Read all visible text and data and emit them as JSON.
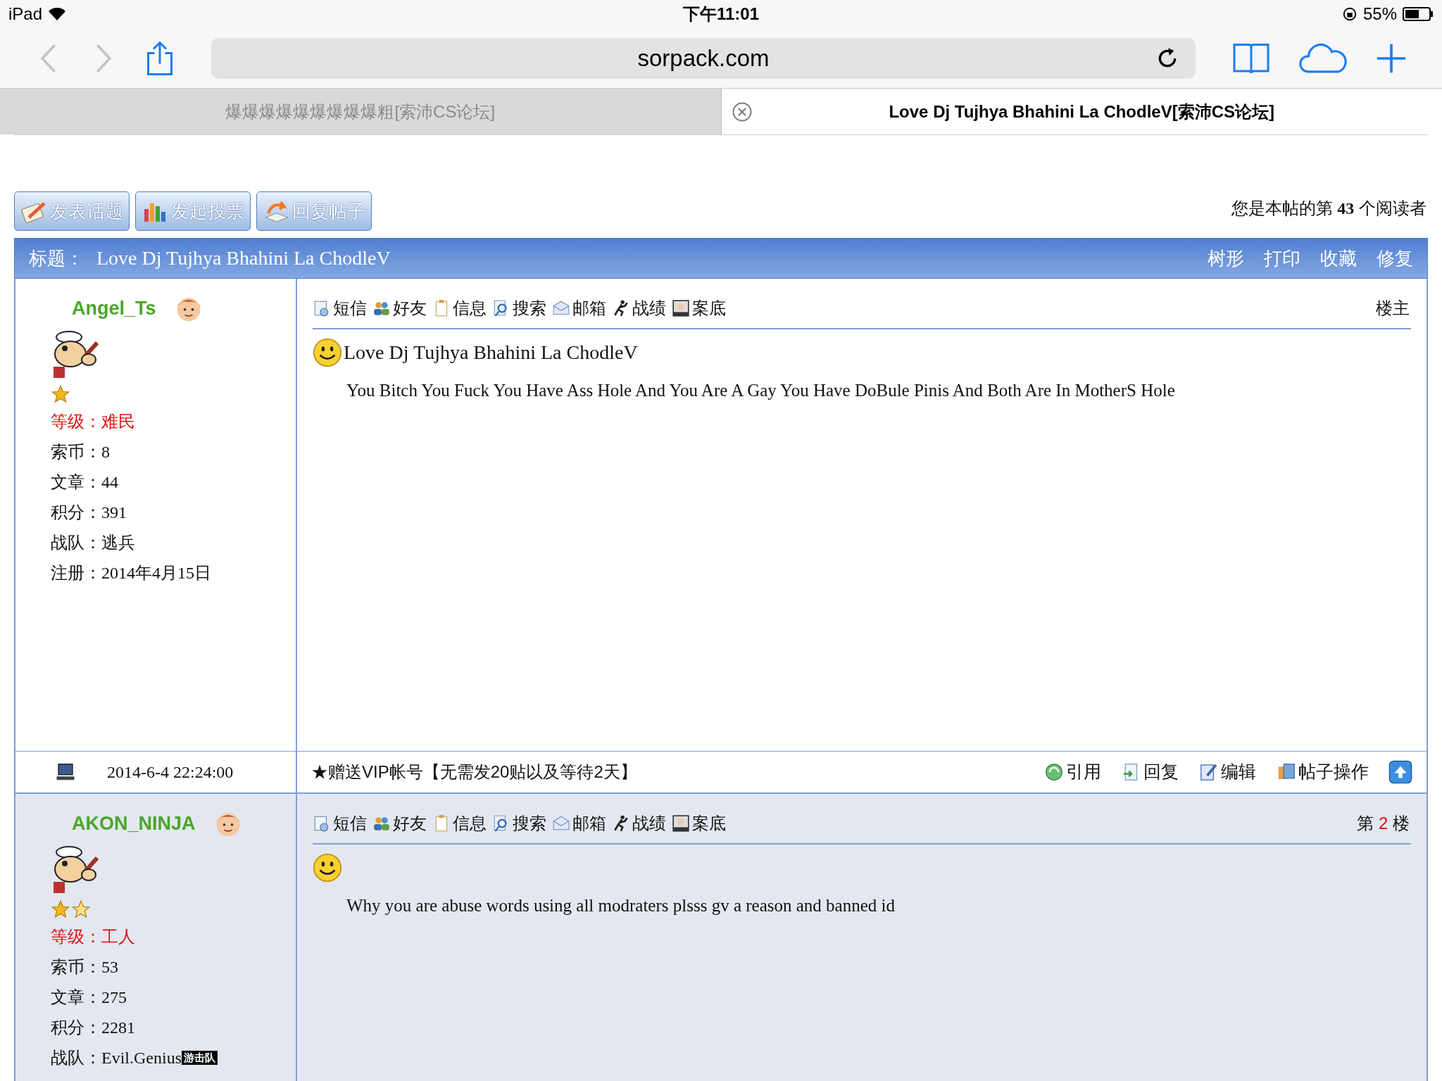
{
  "status_bar": {
    "device": "iPad",
    "time": "下午11:01",
    "battery": "55%"
  },
  "browser": {
    "back_disabled": true,
    "forward_disabled": true,
    "url": "sorpack.com"
  },
  "tabs": [
    {
      "label": "爆爆爆爆爆爆爆爆爆粗[索沛CS论坛]",
      "selected": false
    },
    {
      "label": "Love Dj Tujhya Bhahini La ChodleV[索沛CS论坛]",
      "selected": true
    }
  ],
  "actions": [
    {
      "kind": "topic",
      "label": "发表话题"
    },
    {
      "kind": "poll",
      "label": "发起投票"
    },
    {
      "kind": "reply",
      "label": "回复帖子"
    }
  ],
  "reader_count": {
    "prefix": "您是本帖的第",
    "number": "43",
    "suffix": "个阅读者"
  },
  "thread_header": {
    "label": "标题：",
    "title": "Love Dj Tujhya Bhahini La ChodleV",
    "links": [
      "树形",
      "打印",
      "收藏",
      "修复"
    ]
  },
  "posts": [
    {
      "username": "Angel_Ts",
      "rank_icons": [
        {
          "kind": "star"
        }
      ],
      "rank": {
        "label": "等级：",
        "value": "难民"
      },
      "fields": [
        {
          "label": "索币：",
          "value": "8"
        },
        {
          "label": "文章：",
          "value": "44"
        },
        {
          "label": "积分：",
          "value": "391"
        },
        {
          "label": "战队：",
          "value": "逃兵"
        },
        {
          "label": "注册：",
          "value": "2014年4月15日"
        }
      ],
      "tools": [
        {
          "kind": "message",
          "label": "短信"
        },
        {
          "kind": "friends",
          "label": "好友"
        },
        {
          "kind": "info",
          "label": "信息"
        },
        {
          "kind": "search",
          "label": "搜索"
        },
        {
          "kind": "mail",
          "label": "邮箱"
        },
        {
          "kind": "stats",
          "label": "战绩"
        },
        {
          "kind": "record",
          "label": "案底"
        }
      ],
      "floor": {
        "kind": "owner",
        "text": "楼主"
      },
      "title": "Love Dj Tujhya Bhahini La ChodleV",
      "body": "You Bitch You Fuck You Have Ass Hole And You Are A Gay You Have DoBule Pinis  And Both Are In MotherS Hole",
      "highlighted": false,
      "footer": {
        "date": "2014-6-4 22:24:00",
        "notice": "★赠送VIP帐号【无需发20贴以及等待2天】",
        "buttons": [
          {
            "kind": "quote",
            "label": "引用"
          },
          {
            "kind": "reply",
            "label": "回复"
          },
          {
            "kind": "edit",
            "label": "编辑"
          },
          {
            "kind": "manage",
            "label": "帖子操作"
          }
        ]
      }
    },
    {
      "username": "AKON_NINJA",
      "rank_icons": [
        {
          "kind": "star"
        },
        {
          "kind": "star"
        }
      ],
      "rank": {
        "label": "等级：",
        "value": "工人"
      },
      "fields": [
        {
          "label": "索币：",
          "value": "53"
        },
        {
          "label": "文章：",
          "value": "275"
        },
        {
          "label": "积分：",
          "value": "2281"
        },
        {
          "label": "战队：",
          "value": "Evil.Genius",
          "badge": "游击队"
        }
      ],
      "tools": [
        {
          "kind": "message",
          "label": "短信"
        },
        {
          "kind": "friends",
          "label": "好友"
        },
        {
          "kind": "info",
          "label": "信息"
        },
        {
          "kind": "search",
          "label": "搜索"
        },
        {
          "kind": "mail",
          "label": "邮箱"
        },
        {
          "kind": "stats",
          "label": "战绩"
        },
        {
          "kind": "record",
          "label": "案底"
        }
      ],
      "floor": {
        "kind": "numbered",
        "prefix": "第",
        "number": "2",
        "suffix": "楼"
      },
      "body": "Why you are abuse words using all modraters plsss gv a reason and banned id",
      "highlighted": true
    }
  ]
}
